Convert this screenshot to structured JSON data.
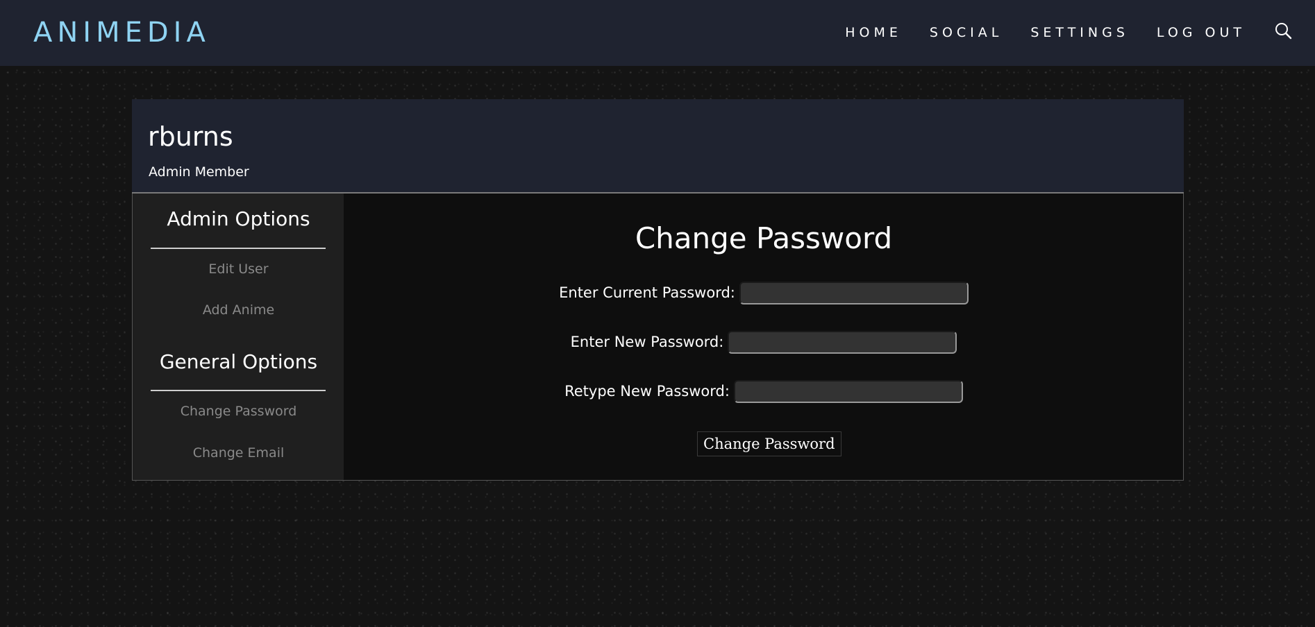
{
  "header": {
    "logo": "ANIMEDIA",
    "nav": [
      "HOME",
      "SOCIAL",
      "SETTINGS",
      "LOG OUT"
    ],
    "search_icon": "search-icon"
  },
  "profile": {
    "username": "rburns",
    "role": "Admin Member"
  },
  "sidebar": {
    "admin_heading": "Admin Options",
    "admin_links": [
      "Edit User",
      "Add Anime"
    ],
    "general_heading": "General Options",
    "general_links": [
      "Change Password",
      "Change Email"
    ]
  },
  "form": {
    "title": "Change Password",
    "current_label": "Enter Current Password:",
    "new_label": "Enter New Password:",
    "retype_label": "Retype New Password:",
    "submit_label": "Change Password"
  },
  "colors": {
    "accent": "#8fd3f2",
    "header_bg": "#1f2330",
    "sidebar_bg": "#1f1f1f",
    "main_bg": "#0e0e0e"
  }
}
